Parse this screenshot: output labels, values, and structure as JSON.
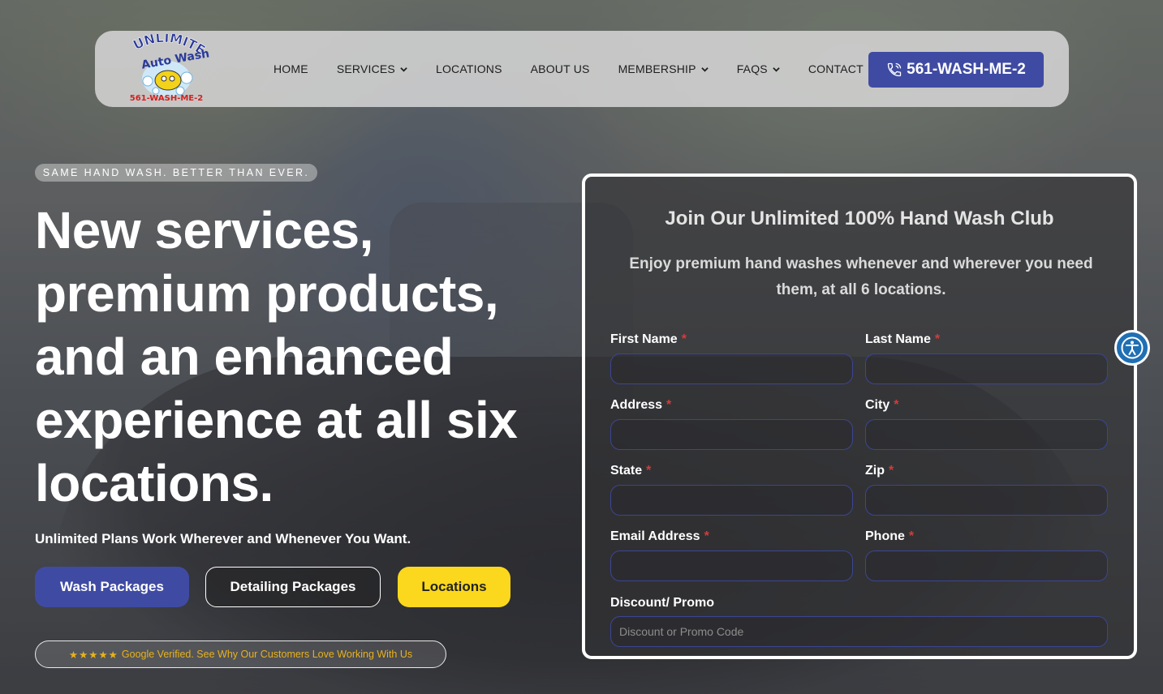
{
  "nav": {
    "logo_text_line1": "UNLIMITED",
    "logo_text_line2": "Auto Wash",
    "logo_phone": "561-WASH-ME-2",
    "items": [
      {
        "label": "HOME",
        "dropdown": false
      },
      {
        "label": "SERVICES",
        "dropdown": true
      },
      {
        "label": "LOCATIONS",
        "dropdown": false
      },
      {
        "label": "ABOUT US",
        "dropdown": false
      },
      {
        "label": "MEMBERSHIP",
        "dropdown": true
      },
      {
        "label": "FAQS",
        "dropdown": true
      },
      {
        "label": "CONTACT",
        "dropdown": false
      }
    ],
    "phone_button": "561-WASH-ME-2"
  },
  "hero": {
    "tagline": "SAME HAND WASH. BETTER THAN EVER.",
    "headline_lines": [
      "New services,",
      "premium products,",
      "and an enhanced",
      "experience at all six",
      "locations."
    ],
    "subline": "Unlimited Plans Work Wherever and Whenever You Want.",
    "buttons": {
      "wash": "Wash Packages",
      "detailing": "Detailing Packages",
      "locations": "Locations"
    },
    "review": {
      "stars": "★★★★★",
      "text": "Google Verified. See Why Our Customers Love Working With Us"
    }
  },
  "form": {
    "title": "Join Our Unlimited 100% Hand Wash Club",
    "description": "Enjoy premium hand washes whenever and wherever you need them, at all 6 locations.",
    "required_marker": "*",
    "fields": {
      "first_name": {
        "label": "First Name",
        "value": ""
      },
      "last_name": {
        "label": "Last Name",
        "value": ""
      },
      "address": {
        "label": "Address",
        "value": ""
      },
      "city": {
        "label": "City",
        "value": ""
      },
      "state": {
        "label": "State",
        "value": ""
      },
      "zip": {
        "label": "Zip",
        "value": ""
      },
      "email": {
        "label": "Email Address",
        "value": ""
      },
      "phone": {
        "label": "Phone",
        "value": ""
      },
      "promo": {
        "label": "Discount/ Promo",
        "placeholder": "Discount or Promo Code",
        "value": ""
      }
    }
  },
  "accessibility": {
    "icon": "accessibility-icon"
  },
  "colors": {
    "brand_blue": "#3f4ba3",
    "accent_yellow": "#fbd81d",
    "required_red": "#d23c3c",
    "star_gold": "#e7b21b"
  }
}
